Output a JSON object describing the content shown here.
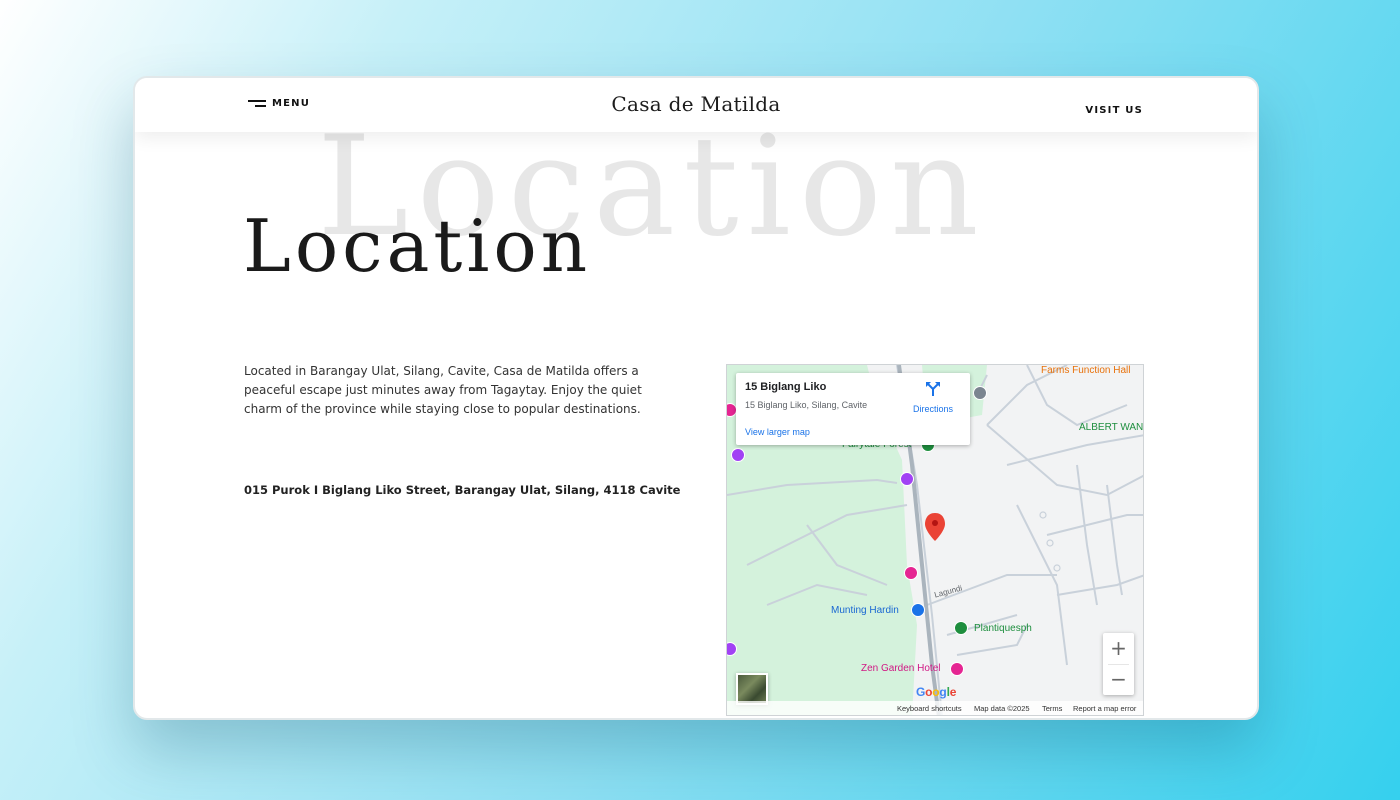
{
  "nav": {
    "menu_label": "MENU",
    "brand": "Casa de Matilda",
    "visit_label": "VISIT US"
  },
  "hero": {
    "background_word": "Location",
    "title": "Location"
  },
  "content": {
    "description": "Located in Barangay Ulat, Silang, Cavite, Casa de Matilda offers a peaceful escape just minutes away from Tagaytay. Enjoy the quiet charm of the province while staying close to popular destinations.",
    "address": "015 Purok I Biglang Liko Street, Barangay Ulat, Silang, 4118 Cavite"
  },
  "map": {
    "place_name": "15 Biglang Liko",
    "place_address": "15 Biglang Liko, Silang, Cavite",
    "directions_label": "Directions",
    "view_larger": "View larger map",
    "labels": {
      "farms": "Farms Function Hall",
      "albert": "ALBERT WAN",
      "fairytale": "Fairytale Forest",
      "lagundi": "Lagundi",
      "munting": "Munting Hardin",
      "plantiques": "Plantiquesph",
      "zen": "Zen Garden Hotel"
    },
    "zoom_in": "+",
    "zoom_out": "−",
    "google": "Google",
    "keyboard_shortcuts": "Keyboard shortcuts",
    "map_data": "Map data ©2025",
    "terms": "Terms",
    "report": "Report a map error",
    "colors": {
      "park": "#d4f2dc",
      "road": "#c9d1da",
      "marker": "#ea4335",
      "link": "#1a73e8"
    }
  }
}
